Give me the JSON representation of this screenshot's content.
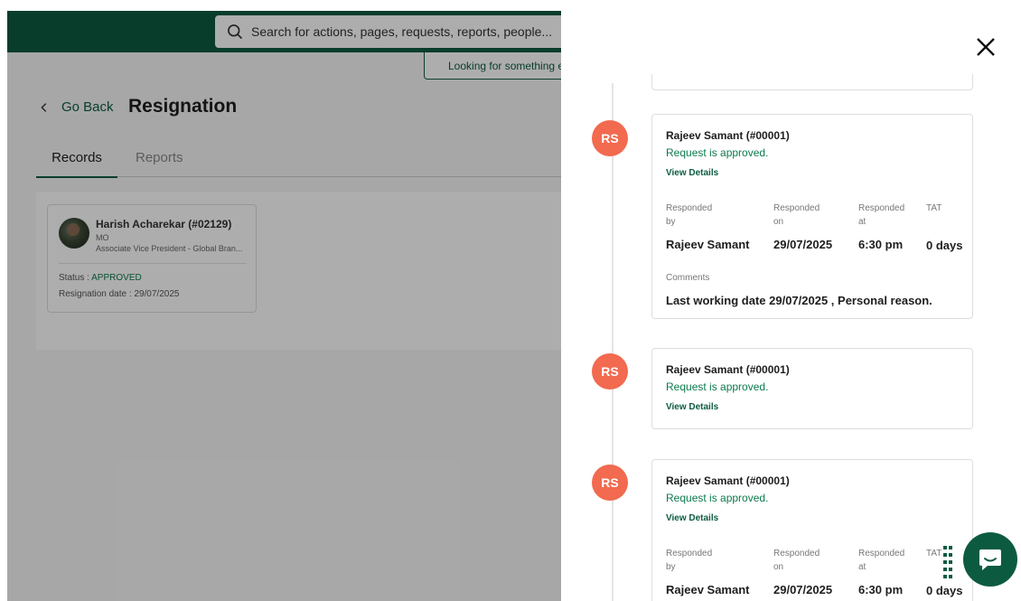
{
  "header": {
    "search_placeholder": "Search for actions, pages, requests, reports, people...",
    "search_hint": "Looking for something e"
  },
  "page": {
    "back_label": "Go Back",
    "title": "Resignation",
    "tabs": [
      {
        "label": "Records",
        "active": true
      },
      {
        "label": "Reports",
        "active": false
      }
    ]
  },
  "record": {
    "name": "Harish Acharekar (#02129)",
    "code": "MO",
    "role": "Associate Vice President - Global Bran...",
    "status_label": "Status :",
    "status_value": "APPROVED",
    "date_label": "Resignation date :",
    "date_value": "29/07/2025"
  },
  "timeline": [
    {
      "initials": "RS",
      "name": "Rajeev Samant (#00001)",
      "message": "Request is approved.",
      "link": "View Details",
      "headers": [
        "Responded\nby",
        "Responded\non",
        "Responded\nat",
        "TAT"
      ],
      "values": [
        "Rajeev Samant",
        "29/07/2025",
        "6:30 pm",
        "0 days"
      ],
      "comments_label": "Comments",
      "comments": "Last working date 29/07/2025 , Personal reason."
    },
    {
      "initials": "RS",
      "name": "Rajeev Samant (#00001)",
      "message": "Request is approved.",
      "link": "View Details"
    },
    {
      "initials": "RS",
      "name": "Rajeev Samant (#00001)",
      "message": "Request is approved.",
      "link": "View Details",
      "headers": [
        "Responded\nby",
        "Responded\non",
        "Responded\nat",
        "TAT"
      ],
      "values": [
        "Rajeev Samant",
        "29/07/2025",
        "6:30 pm",
        "0 days"
      ]
    }
  ],
  "colors": {
    "brand": "#0c5b41",
    "approved": "#0c7a4d",
    "avatar_bubble": "#f26a4f"
  },
  "icons": [
    "search-icon",
    "chevron-left-icon",
    "close-icon",
    "grid-dots-icon",
    "chat-icon"
  ]
}
